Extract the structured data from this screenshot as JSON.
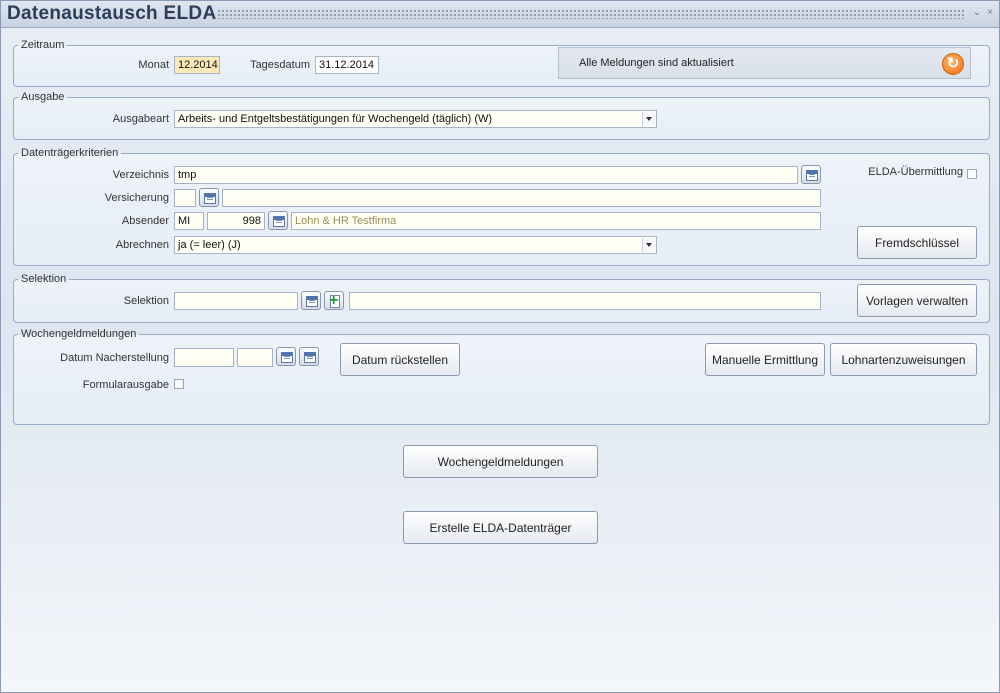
{
  "window": {
    "title": "Datenaustausch ELDA",
    "minimize_glyph": "⌄",
    "close_glyph": "×"
  },
  "zeitraum": {
    "legend": "Zeitraum",
    "monat_label": "Monat",
    "monat_value": "12.2014",
    "tagesdatum_label": "Tagesdatum",
    "tagesdatum_value": "31.12.2014",
    "status_text": "Alle Meldungen sind aktualisiert",
    "refresh_icon": "refresh-icon"
  },
  "ausgabe": {
    "legend": "Ausgabe",
    "ausgabeart_label": "Ausgabeart",
    "ausgabeart_value": "Arbeits- und Entgeltsbestätigungen für Wochengeld (täglich) (W)"
  },
  "datentraeger": {
    "legend": "Datenträgerkriterien",
    "verzeichnis_label": "Verzeichnis",
    "verzeichnis_value": "tmp",
    "versicherung_label": "Versicherung",
    "versicherung_code": "",
    "versicherung_name": "",
    "absender_label": "Absender",
    "absender_code": "MI",
    "absender_number": "998",
    "absender_name": "Lohn & HR Testfirma",
    "abrechnen_label": "Abrechnen",
    "abrechnen_value": "ja (= leer) (J)",
    "elda_label": "ELDA-Übermittlung",
    "fremdschluessel_button": "Fremdschlüssel"
  },
  "selektion": {
    "legend": "Selektion",
    "selektion_label": "Selektion",
    "selektion_code": "",
    "selektion_text": "",
    "vorlagen_button": "Vorlagen verwalten"
  },
  "wochengeld": {
    "legend": "Wochengeldmeldungen",
    "datum_label": "Datum Nacherstellung",
    "datum_from": "",
    "datum_to": "",
    "formular_label": "Formularausgabe",
    "datum_reset_button": "Datum rückstellen",
    "manuelle_button": "Manuelle Ermittlung",
    "lohnarten_button": "Lohnartenzuweisungen"
  },
  "actions": {
    "wochengeld_button": "Wochengeldmeldungen",
    "erstelle_button": "Erstelle ELDA-Datenträger"
  },
  "colors": {
    "title": "#2c3d57",
    "highlight_field": "#fde8b8",
    "refresh_accent": "#f07012"
  }
}
